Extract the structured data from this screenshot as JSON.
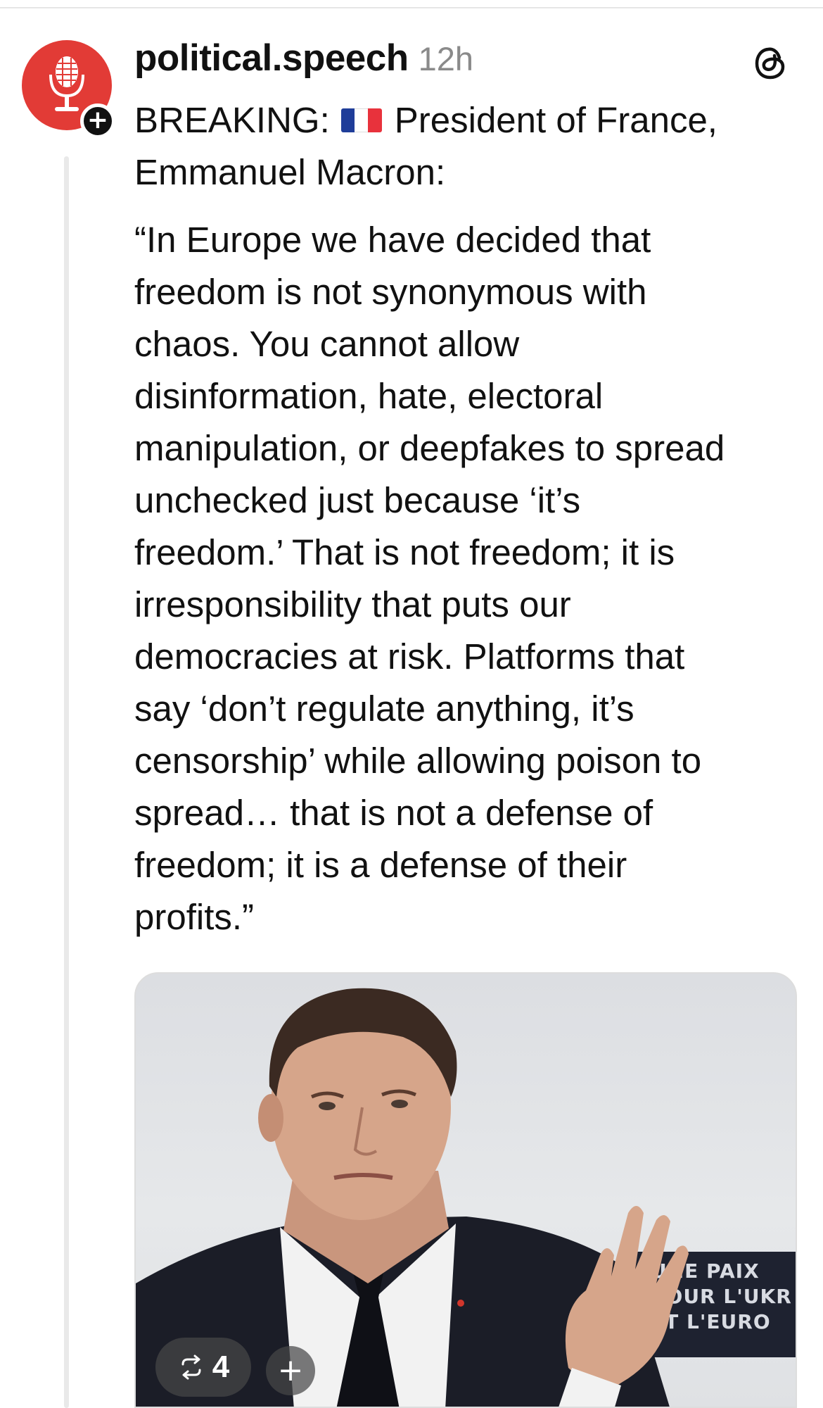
{
  "post": {
    "username": "political.speech",
    "timestamp": "12h",
    "headline_prefix": "BREAKING:",
    "headline_rest": "President of France,",
    "headline_line2": "Emmanuel Macron:",
    "quote_lines": [
      "“In Europe we have decided that",
      "freedom is not synonymous with",
      "chaos. You cannot allow",
      "disinformation, hate, electoral",
      "manipulation, or deepfakes to spread",
      "unchecked just because ‘it’s",
      "freedom.’ That is not freedom; it is",
      "irresponsibility that puts our",
      "democracies at risk. Platforms that",
      "say ‘don’t regulate anything, it’s",
      "censorship’ while allowing poison to",
      "spread… that is not a defense of",
      "freedom; it is a defense of their",
      "profits.”"
    ],
    "flag_icon": "france-flag-icon",
    "avatar_icon": "microphone-icon",
    "follow_icon": "plus-icon",
    "follow_symbol": "+",
    "threads_icon": "threads-logo-icon",
    "colors": {
      "avatar_bg": "#e23b36",
      "flag_blue": "#1f3d99",
      "flag_white": "#ffffff",
      "flag_red": "#e8323c",
      "timestamp": "#8a8a8a"
    }
  },
  "media": {
    "backdrop_sign_lines": [
      "UNE PAIX",
      "POUR L'UKR",
      "ET L'EURO"
    ],
    "repost_icon": "repost-icon",
    "repost_count": "4",
    "add_icon": "plus-icon",
    "add_symbol": "+"
  }
}
